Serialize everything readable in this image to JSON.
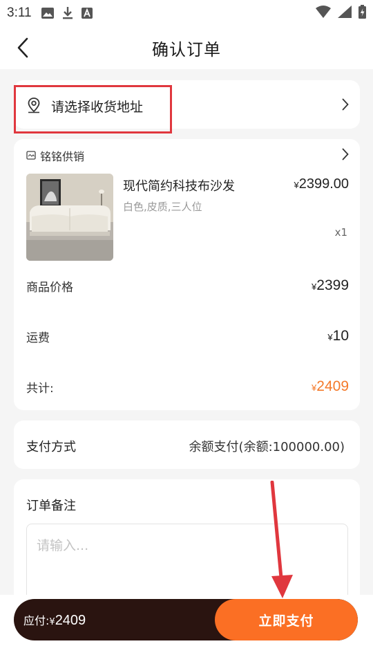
{
  "status_bar": {
    "time": "3:11",
    "icons": [
      "image-icon",
      "download-icon",
      "font-a-icon",
      "wifi-icon",
      "signal-icon",
      "battery-charging-icon"
    ]
  },
  "nav": {
    "title": "确认订单",
    "back_icon": "chevron-left-icon"
  },
  "address": {
    "placeholder": "请选择收货地址",
    "icon": "location-pin-icon"
  },
  "order": {
    "shop_name": "铭铭供销",
    "product": {
      "name": "现代简约科技布沙发",
      "spec": "白色,皮质,三人位",
      "price_symbol": "¥",
      "price": "2399.00",
      "qty": "x1"
    },
    "summary": [
      {
        "label": "商品价格",
        "symbol": "¥",
        "value": "2399"
      },
      {
        "label": "运费",
        "symbol": "¥",
        "value": "10"
      },
      {
        "label": "共计:",
        "symbol": "¥",
        "value": "2409"
      }
    ]
  },
  "payment": {
    "label": "支付方式",
    "value": "余额支付(余额:100000.00)"
  },
  "remark": {
    "label": "订单备注",
    "placeholder": "请输入..."
  },
  "footer": {
    "amount_label": "应付:",
    "amount_symbol": "¥",
    "amount_value": "2409",
    "pay_button": "立即支付"
  },
  "colors": {
    "accent": "#fb6f24",
    "total": "#f47a2b",
    "bar_dark": "#2a1410",
    "annotation_red": "#e0373e"
  }
}
